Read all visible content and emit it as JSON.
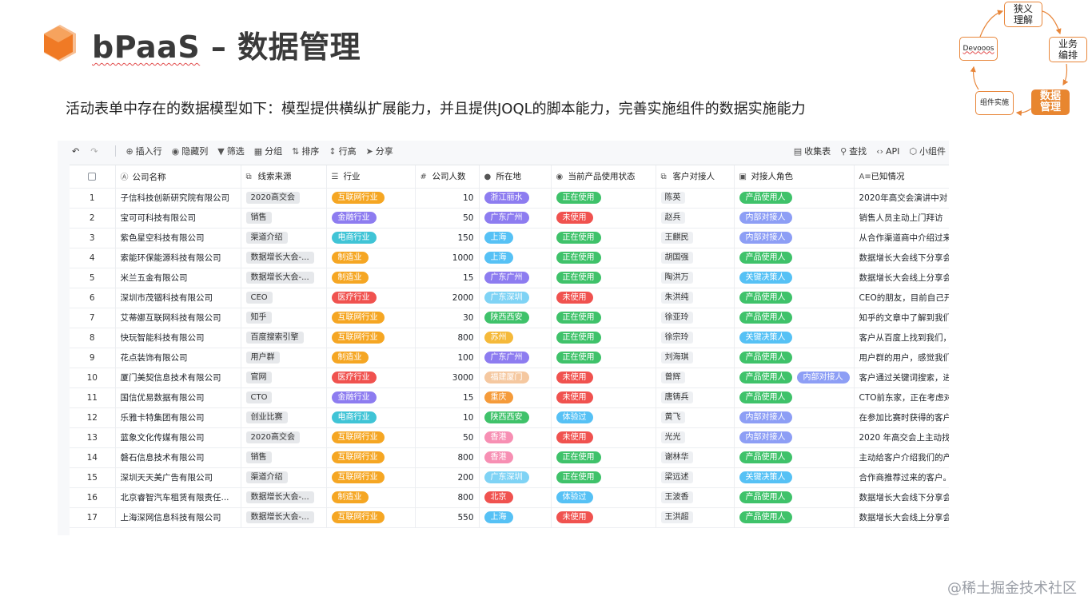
{
  "header": {
    "title_brand": "bPaaS",
    "title_rest": " – 数据管理",
    "subtitle": "活动表单中存在的数据模型如下：模型提供横纵扩展能力，并且提供JOQL的脚本能力，完善实施组件的数据实施能力"
  },
  "cycle": {
    "top": "狭义\n理解",
    "right": "业务\n编排",
    "bottom_right": "数据\n管理",
    "bottom_left": "组件实施",
    "left": "Devooos"
  },
  "toolbar": {
    "insert_row": "插入行",
    "hide_col": "隐藏列",
    "filter": "筛选",
    "group": "分组",
    "sort": "排序",
    "row_height": "行高",
    "share": "分享",
    "collect": "收集表",
    "find": "查找",
    "api": "API",
    "widget": "小组件"
  },
  "table": {
    "columns": [
      "公司名称",
      "线索来源",
      "行业",
      "公司人数",
      "所在地",
      "当前产品使用状态",
      "客户对接人",
      "对接人角色",
      "已知情况"
    ],
    "rows": [
      {
        "idx": "1",
        "company": "子信科技创新研究院有限公司",
        "source": "2020高交会",
        "industry": "互联网行业",
        "industry_color": "#f5a623",
        "size": "10",
        "location": "浙江丽水",
        "location_color": "#8d7cf0",
        "status": "正在使用",
        "status_color": "#3fc26a",
        "contact": "陈英",
        "roles": [
          {
            "label": "产品使用人",
            "color": "#3fc26a"
          }
        ],
        "info": "2020年高交会演讲中对"
      },
      {
        "idx": "2",
        "company": "宝可可科技有限公司",
        "source": "销售",
        "industry": "金融行业",
        "industry_color": "#8d7cf0",
        "size": "50",
        "location": "广东广州",
        "location_color": "#8d7cf0",
        "status": "未使用",
        "status_color": "#f0524f",
        "contact": "赵兵",
        "roles": [
          {
            "label": "内部对接人",
            "color": "#8d9ef5"
          }
        ],
        "info": "销售人员主动上门拜访"
      },
      {
        "idx": "3",
        "company": "紫色星空科技有限公司",
        "source": "渠道介绍",
        "industry": "电商行业",
        "industry_color": "#40c4d6",
        "size": "150",
        "location": "上海",
        "location_color": "#56c1f5",
        "status": "正在使用",
        "status_color": "#3fc26a",
        "contact": "王麒民",
        "roles": [
          {
            "label": "内部对接人",
            "color": "#8d9ef5"
          }
        ],
        "info": "从合作渠道商中介绍过来"
      },
      {
        "idx": "4",
        "company": "索能环保能源科技有限公司",
        "source": "数据增长大会-...",
        "industry": "制造业",
        "industry_color": "#f5a623",
        "size": "1000",
        "location": "上海",
        "location_color": "#56c1f5",
        "status": "正在使用",
        "status_color": "#3fc26a",
        "contact": "胡国强",
        "roles": [
          {
            "label": "产品使用人",
            "color": "#3fc26a"
          }
        ],
        "info": "数据增长大会线下分享会"
      },
      {
        "idx": "5",
        "company": "米兰五金有限公司",
        "source": "数据增长大会-...",
        "industry": "制造业",
        "industry_color": "#f5a623",
        "size": "15",
        "location": "广东广州",
        "location_color": "#8d7cf0",
        "status": "正在使用",
        "status_color": "#3fc26a",
        "contact": "陶洪万",
        "roles": [
          {
            "label": "关键决策人",
            "color": "#56c1f5"
          }
        ],
        "info": "数据增长大会线上分享会"
      },
      {
        "idx": "6",
        "company": "深圳市茂锢科技有限公司",
        "source": "CEO",
        "industry": "医疗行业",
        "industry_color": "#f0524f",
        "size": "2000",
        "location": "广东深圳",
        "location_color": "#7fd3f5",
        "status": "未使用",
        "status_color": "#f0524f",
        "contact": "朱洪纯",
        "roles": [
          {
            "label": "产品使用人",
            "color": "#3fc26a"
          }
        ],
        "info": "CEO的朋友，目前自己开"
      },
      {
        "idx": "7",
        "company": "艾蒂娜互联网科技有限公司",
        "source": "知乎",
        "industry": "互联网行业",
        "industry_color": "#f5a623",
        "size": "30",
        "location": "陕西西安",
        "location_color": "#3fc26a",
        "status": "正在使用",
        "status_color": "#3fc26a",
        "contact": "徐亚玲",
        "roles": [
          {
            "label": "产品使用人",
            "color": "#3fc26a"
          }
        ],
        "info": "知乎的文章中了解到我们"
      },
      {
        "idx": "8",
        "company": "快玩智能科技有限公司",
        "source": "百度搜索引擎",
        "industry": "互联网行业",
        "industry_color": "#f5a623",
        "size": "800",
        "location": "苏州",
        "location_color": "#f5b93a",
        "status": "正在使用",
        "status_color": "#3fc26a",
        "contact": "徐宗玲",
        "roles": [
          {
            "label": "关键决策人",
            "color": "#56c1f5"
          }
        ],
        "info": "客户从百度上找到我们，"
      },
      {
        "idx": "9",
        "company": "花点装饰有限公司",
        "source": "用户群",
        "industry": "制造业",
        "industry_color": "#f5a623",
        "size": "100",
        "location": "广东广州",
        "location_color": "#8d7cf0",
        "status": "正在使用",
        "status_color": "#3fc26a",
        "contact": "刘海琪",
        "roles": [
          {
            "label": "产品使用人",
            "color": "#3fc26a"
          }
        ],
        "info": "用户群的用户，感觉我们"
      },
      {
        "idx": "10",
        "company": "厦门美契信息技术有限公司",
        "source": "官网",
        "industry": "医疗行业",
        "industry_color": "#f0524f",
        "size": "3000",
        "location": "福建厦门",
        "location_color": "#f5c8a0",
        "status": "未使用",
        "status_color": "#f0524f",
        "contact": "曾辉",
        "roles": [
          {
            "label": "产品使用人",
            "color": "#3fc26a"
          },
          {
            "label": "内部对接人",
            "color": "#8d9ef5"
          }
        ],
        "info": "客户通过关键词搜索，进"
      },
      {
        "idx": "11",
        "company": "国信优易数据有限公司",
        "source": "CTO",
        "industry": "金融行业",
        "industry_color": "#8d7cf0",
        "size": "15",
        "location": "重庆",
        "location_color": "#f59b3a",
        "status": "未使用",
        "status_color": "#f0524f",
        "contact": "唐铸兵",
        "roles": [
          {
            "label": "产品使用人",
            "color": "#3fc26a"
          }
        ],
        "info": "CTO前东家，正在考虑对"
      },
      {
        "idx": "12",
        "company": "乐雅卡特集团有限公司",
        "source": "创业比赛",
        "industry": "电商行业",
        "industry_color": "#40c4d6",
        "size": "10",
        "location": "陕西西安",
        "location_color": "#3fc26a",
        "status": "体验过",
        "status_color": "#56c1f5",
        "contact": "黄飞",
        "roles": [
          {
            "label": "内部对接人",
            "color": "#8d9ef5"
          }
        ],
        "info": "在参加比赛时获得的客户"
      },
      {
        "idx": "13",
        "company": "蓝象文化传媒有限公司",
        "source": "2020高交会",
        "industry": "互联网行业",
        "industry_color": "#f5a623",
        "size": "50",
        "location": "香港",
        "location_color": "#f78fb3",
        "status": "未使用",
        "status_color": "#f0524f",
        "contact": "光光",
        "roles": [
          {
            "label": "内部对接人",
            "color": "#8d9ef5"
          }
        ],
        "info": "2020 年高交会上主动找"
      },
      {
        "idx": "14",
        "company": "磐石信息技术有限公司",
        "source": "销售",
        "industry": "互联网行业",
        "industry_color": "#f5a623",
        "size": "800",
        "location": "香港",
        "location_color": "#f78fb3",
        "status": "正在使用",
        "status_color": "#3fc26a",
        "contact": "谢林华",
        "roles": [
          {
            "label": "产品使用人",
            "color": "#3fc26a"
          }
        ],
        "info": "主动给客户介绍我们的产"
      },
      {
        "idx": "15",
        "company": "深圳天天美广告有限公司",
        "source": "渠道介绍",
        "industry": "互联网行业",
        "industry_color": "#f5a623",
        "size": "200",
        "location": "广东深圳",
        "location_color": "#7fd3f5",
        "status": "正在使用",
        "status_color": "#3fc26a",
        "contact": "梁远述",
        "roles": [
          {
            "label": "关键决策人",
            "color": "#56c1f5"
          }
        ],
        "info": "合作商推荐过来的客户。"
      },
      {
        "idx": "16",
        "company": "北京睿智汽车租赁有限责任...",
        "source": "数据增长大会-...",
        "industry": "制造业",
        "industry_color": "#f5a623",
        "size": "800",
        "location": "北京",
        "location_color": "#f0524f",
        "status": "体验过",
        "status_color": "#56c1f5",
        "contact": "王波香",
        "roles": [
          {
            "label": "产品使用人",
            "color": "#3fc26a"
          }
        ],
        "info": "数据增长大会线下分享会"
      },
      {
        "idx": "17",
        "company": "上海深网信息科技有限公司",
        "source": "数据增长大会-...",
        "industry": "互联网行业",
        "industry_color": "#f5a623",
        "size": "550",
        "location": "上海",
        "location_color": "#56c1f5",
        "status": "未使用",
        "status_color": "#f0524f",
        "contact": "王洪超",
        "roles": [
          {
            "label": "产品使用人",
            "color": "#3fc26a"
          }
        ],
        "info": "数据增长大会线上分享会"
      }
    ]
  },
  "watermark": "@稀土掘金技术社区"
}
